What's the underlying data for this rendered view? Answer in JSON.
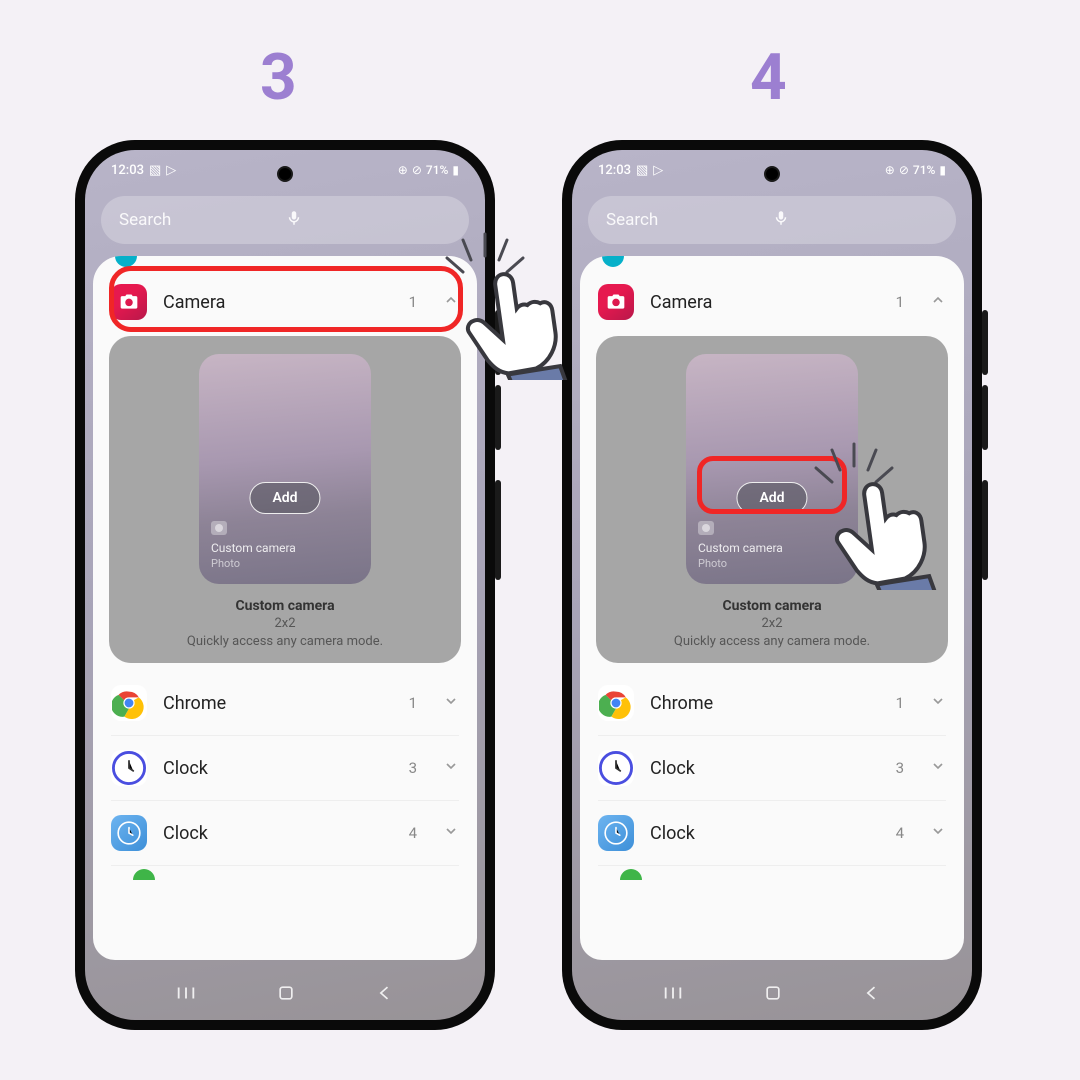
{
  "steps": {
    "left": "3",
    "right": "4"
  },
  "status": {
    "time": "12:03",
    "battery": "71%"
  },
  "search": {
    "placeholder": "Search"
  },
  "widget_row": {
    "label": "Camera",
    "count": "1"
  },
  "widget_preview": {
    "add_label": "Add",
    "overlay_line1": "Custom camera",
    "overlay_line2": "Photo",
    "title": "Custom camera",
    "size": "2x2",
    "desc": "Quickly access any camera mode."
  },
  "list": [
    {
      "label": "Chrome",
      "count": "1"
    },
    {
      "label": "Clock",
      "count": "3"
    },
    {
      "label": "Clock",
      "count": "4"
    }
  ],
  "colors": {
    "accent": "#9c7fd1",
    "highlight": "#f02626"
  }
}
